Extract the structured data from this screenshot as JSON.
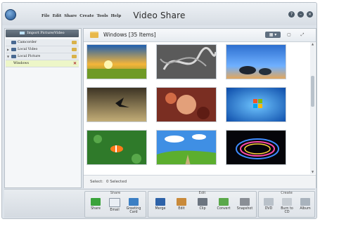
{
  "app": {
    "title": "Video Share",
    "menu": [
      "File",
      "Edit",
      "Share",
      "Create",
      "Tools",
      "Help"
    ],
    "window_buttons": [
      "?",
      "–",
      "×"
    ]
  },
  "sidebar": {
    "import_label": "Import Picture/Video",
    "items": [
      {
        "label": "Camcorder"
      },
      {
        "label": "Local Video"
      },
      {
        "label": "Local Picture"
      },
      {
        "label": "Windows"
      }
    ]
  },
  "main": {
    "folder_title": "Windows [35 Items]",
    "view_buttons": [
      "▦ ▾",
      "▢",
      "⤢"
    ],
    "status": {
      "select_label": "Select:",
      "selected_text": "0 Selected"
    }
  },
  "toolbar": {
    "groups": [
      {
        "label": "Share",
        "tools": [
          "Share",
          "Email",
          "Greeting Card"
        ]
      },
      {
        "label": "Edit",
        "tools": [
          "Merge",
          "Edit",
          "Clip",
          "Convert",
          "Snapshot"
        ]
      },
      {
        "label": "Create",
        "tools": [
          "DVD",
          "Burn to CD",
          "Album"
        ]
      }
    ]
  },
  "colors": {
    "accent": "#4c5865",
    "selected_tree_bg": "#edf6c8",
    "panel_bg": "#dde3ea"
  }
}
